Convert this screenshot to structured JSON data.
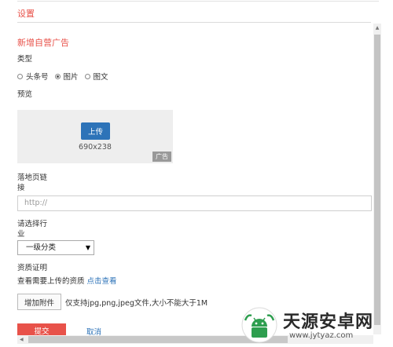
{
  "header": {
    "title": "设置"
  },
  "form": {
    "section_title": "新增自营广告",
    "type_label": "类型",
    "type_options": [
      {
        "label": "头条号",
        "checked": false
      },
      {
        "label": "图片",
        "checked": true
      },
      {
        "label": "图文",
        "checked": false
      }
    ],
    "preview_label": "预览",
    "upload_label": "上传",
    "image_size": "690x238",
    "ad_tag": "广告",
    "landing_label_line1": "落地页链",
    "landing_label_line2": "接",
    "landing_placeholder": "http://",
    "industry_label_line1": "请选择行",
    "industry_label_line2": "业",
    "industry_selected": "一级分类",
    "qualification_label": "资质证明",
    "qualification_hint": "查看需要上传的资质",
    "qualification_link": "点击查看",
    "attach_label": "增加附件",
    "attach_note": "仅支持jpg,png,jpeg文件,大小不能大于1M",
    "submit_label": "提交",
    "cancel_label": "取消"
  },
  "watermark": {
    "title": "天源安卓网",
    "url": "www.jytyaz.com",
    "icon": "android-logo-icon",
    "brand_color": "#2e9e4f"
  },
  "colors": {
    "accent_red": "#e8524a",
    "accent_blue": "#2d73b8"
  }
}
